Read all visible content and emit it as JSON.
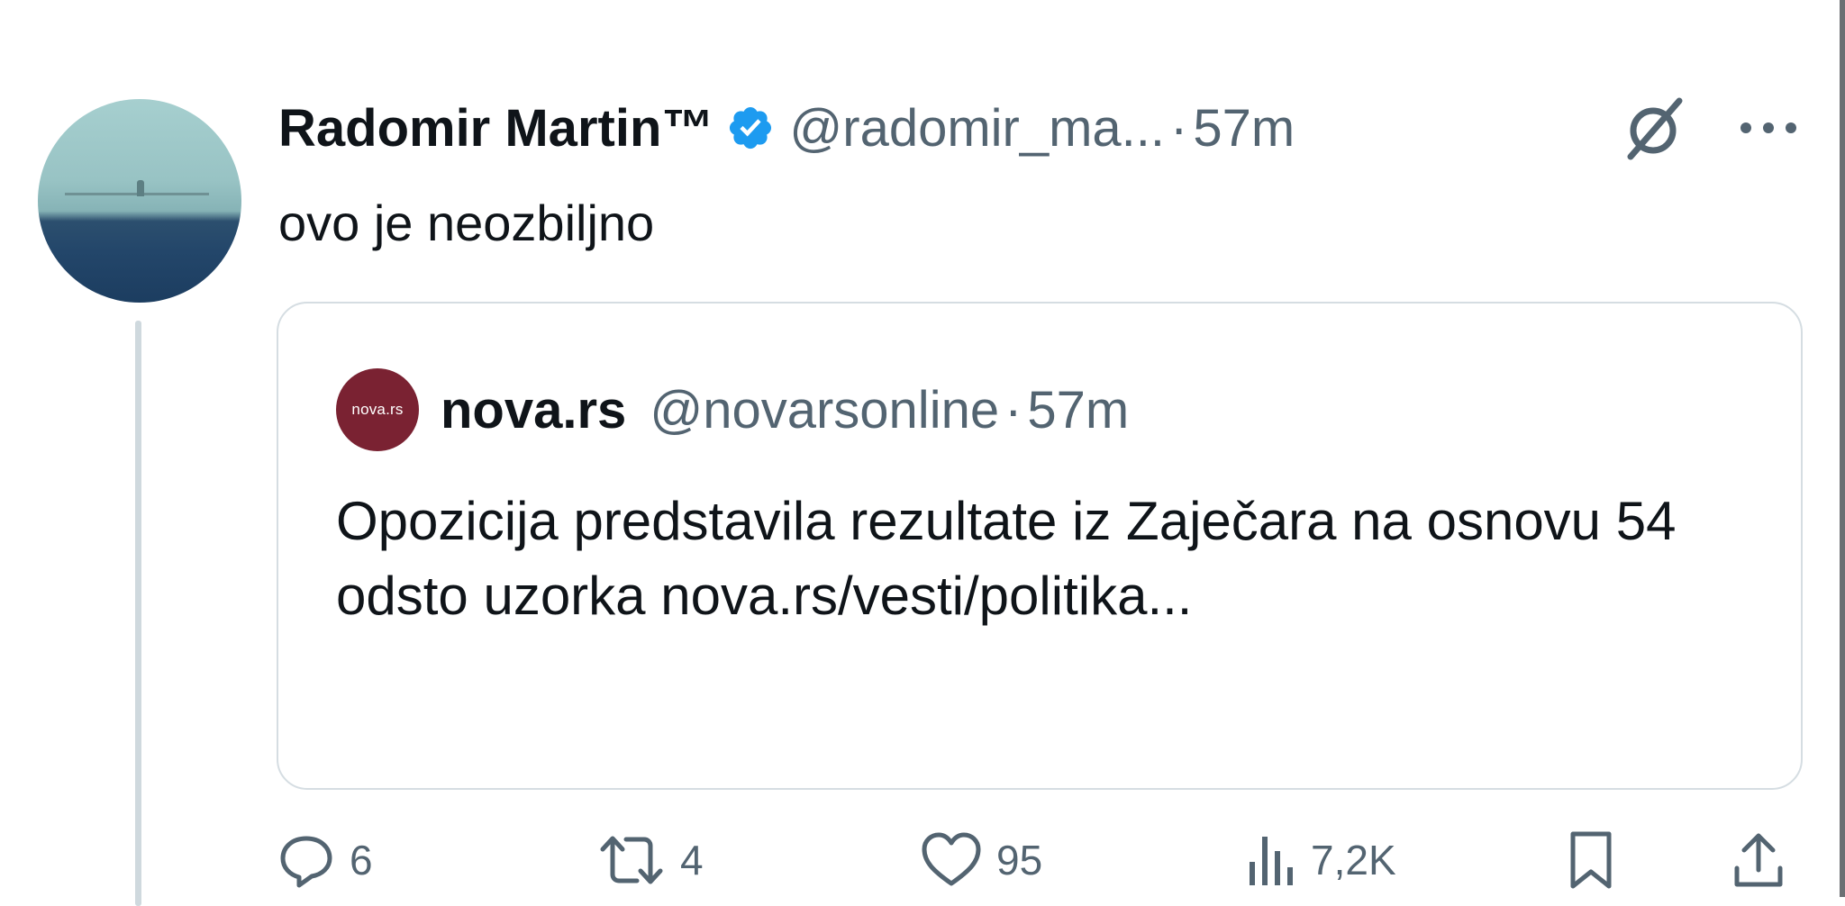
{
  "tweet": {
    "author": {
      "display_name": "Radomir Martin™",
      "handle": "@radomir_ma...",
      "verified": true,
      "avatar_icon": "avatar-photo"
    },
    "separator": "·",
    "time": "57m",
    "text": "ovo je neozbiljno",
    "header_icons": [
      "grok-icon",
      "more-icon"
    ]
  },
  "quote": {
    "avatar_text": "nova.rs",
    "avatar_color": "#7a2232",
    "display_name": "nova.rs",
    "handle": "@novarsonline",
    "separator": "·",
    "time": "57m",
    "text": "Opozicija predstavila rezultate iz Zaječara na osnovu 54 odsto uzorka nova.rs/vesti/politika..."
  },
  "actions": {
    "replies": {
      "icon": "reply-icon",
      "count": "6"
    },
    "retweets": {
      "icon": "retweet-icon",
      "count": "4"
    },
    "likes": {
      "icon": "heart-icon",
      "count": "95"
    },
    "views": {
      "icon": "views-icon",
      "count": "7,2K"
    },
    "bookmark": {
      "icon": "bookmark-icon"
    },
    "share": {
      "icon": "share-icon"
    }
  },
  "colors": {
    "text_primary": "#0f1419",
    "text_secondary": "#536471",
    "verified_blue": "#1d9bf0",
    "border": "#d5dde2"
  }
}
